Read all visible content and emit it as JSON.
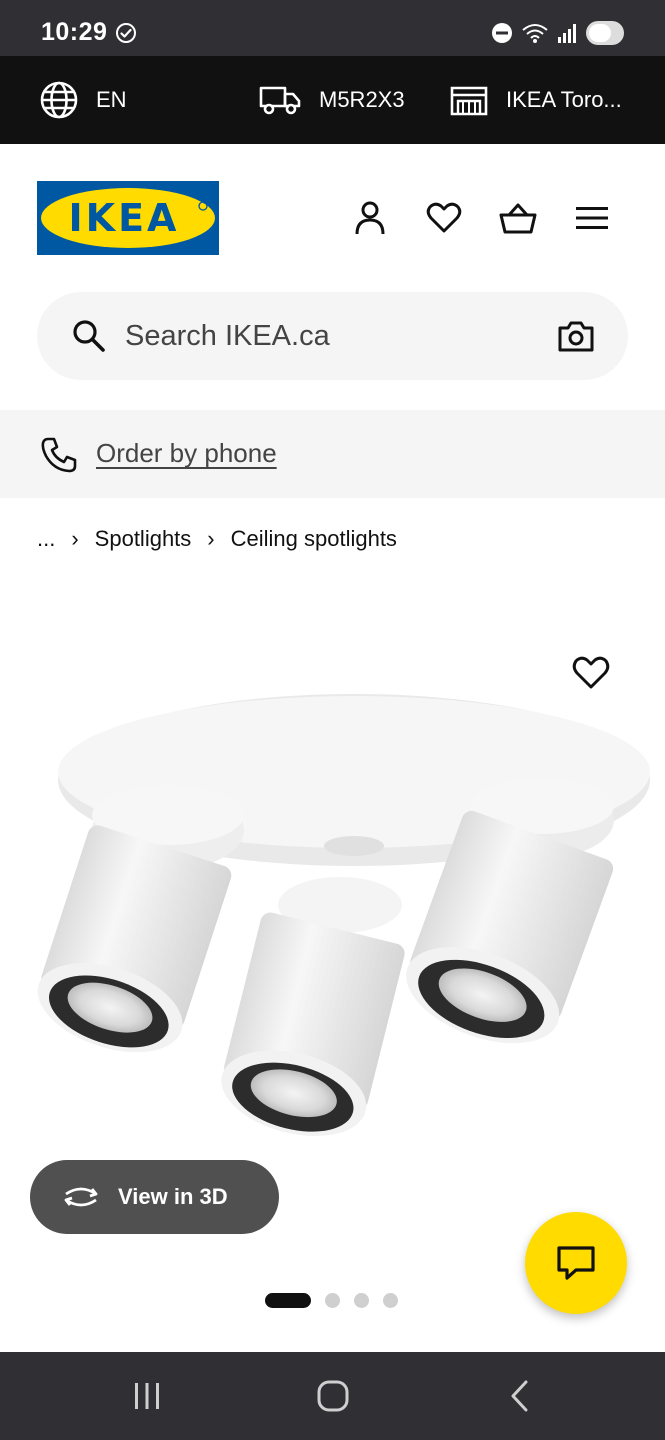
{
  "status_bar": {
    "time": "10:29",
    "icons": [
      "check-circle-icon",
      "do-not-disturb-icon",
      "wifi-icon",
      "signal-icon",
      "battery-icon"
    ]
  },
  "top_bar": {
    "language": "EN",
    "postal_code": "M5R2X3",
    "store": "IKEA Toro..."
  },
  "header": {
    "logo_text": "IKEA",
    "icons": [
      "account-icon",
      "heart-icon",
      "cart-icon",
      "menu-icon"
    ]
  },
  "search": {
    "placeholder": "Search IKEA.ca"
  },
  "order_by_phone": {
    "label": "Order by phone"
  },
  "breadcrumb": {
    "items": [
      "...",
      "Spotlights",
      "Ceiling spotlights"
    ]
  },
  "product": {
    "view_3d_label": "View in 3D",
    "gallery": {
      "active_index": 0,
      "count": 4
    }
  },
  "colors": {
    "ikea_blue": "#0058a3",
    "ikea_yellow": "#ffdb00",
    "dark": "#111111"
  }
}
